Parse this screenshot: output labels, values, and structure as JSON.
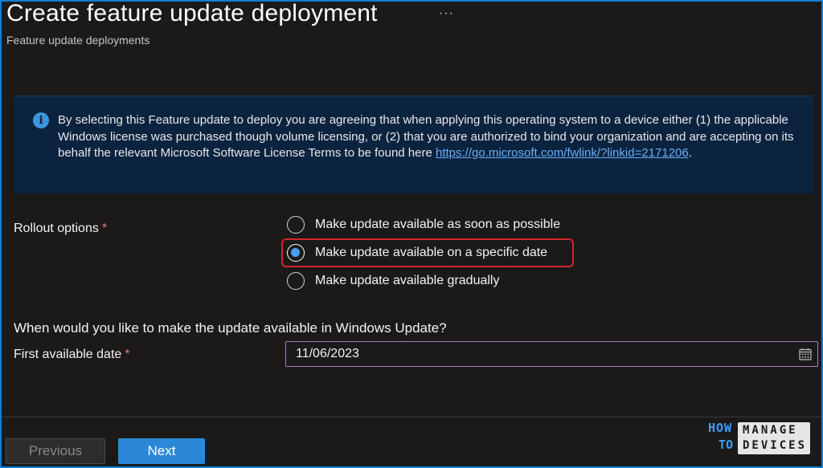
{
  "header": {
    "title": "Create feature update deployment",
    "more_label": "···",
    "subtitle": "Feature update deployments"
  },
  "info": {
    "icon": "info-icon",
    "icon_glyph": "i",
    "text": "By selecting this Feature update to deploy you are agreeing that when applying this operating system to a device either (1) the applicable Windows license was purchased though volume licensing, or (2) that you are authorized to bind your organization and are accepting on its behalf the relevant Microsoft Software License Terms to be found here ",
    "link": "https://go.microsoft.com/fwlink/?linkid=2171206",
    "suffix": "."
  },
  "rollout": {
    "label": "Rollout options",
    "required_marker": "*",
    "options": [
      {
        "label": "Make update available as soon as possible",
        "selected": false
      },
      {
        "label": "Make update available on a specific date",
        "selected": true
      },
      {
        "label": "Make update available gradually",
        "selected": false
      }
    ]
  },
  "availability": {
    "question": "When would you like to make the update available in Windows Update?",
    "date_label": "First available date",
    "required_marker": "*",
    "date_value": "11/06/2023",
    "calendar_icon": "calendar-icon"
  },
  "footer": {
    "previous_label": "Previous",
    "next_label": "Next"
  },
  "logo": {
    "line1": "HOW",
    "line2": "TO",
    "box_line1": "MANAGE",
    "box_line2": "DEVICES"
  },
  "colors": {
    "accent": "#2b88d8",
    "highlight": "#d4262b",
    "info_background": "#0c2340",
    "required": "#f1707b"
  }
}
